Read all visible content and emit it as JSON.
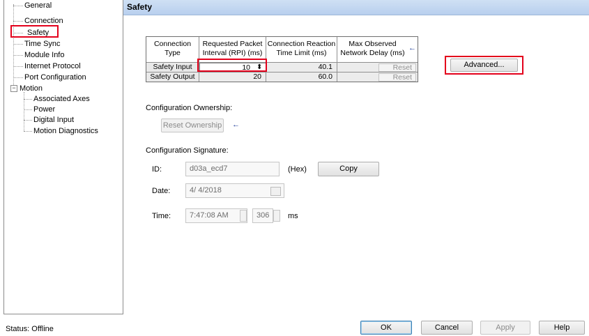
{
  "tree": {
    "items": [
      {
        "label": "General"
      },
      {
        "label": "Connection"
      },
      {
        "label": "Safety"
      },
      {
        "label": "Time Sync"
      },
      {
        "label": "Module Info"
      },
      {
        "label": "Internet Protocol"
      },
      {
        "label": "Port Configuration"
      },
      {
        "label": "Motion"
      },
      {
        "label": "Associated Axes"
      },
      {
        "label": "Power"
      },
      {
        "label": "Digital Input"
      },
      {
        "label": "Motion Diagnostics"
      }
    ],
    "expander_symbol": "−"
  },
  "page": {
    "title": "Safety"
  },
  "table": {
    "headers": [
      [
        "Connection",
        "Type"
      ],
      [
        "Requested Packet",
        "Interval (RPI) (ms)"
      ],
      [
        "Connection Reaction",
        "Time Limit (ms)"
      ],
      [
        "Max Observed",
        "Network Delay (ms)"
      ]
    ],
    "rows": [
      {
        "type": "Safety Input",
        "rpi": "10",
        "reaction": "40.1",
        "delay": "",
        "reset": "Reset"
      },
      {
        "type": "Safety Output",
        "rpi": "20",
        "reaction": "60.0",
        "delay": "",
        "reset": "Reset"
      }
    ],
    "spinner_glyph": "⬍"
  },
  "advanced_button": "Advanced...",
  "ownership": {
    "label": "Configuration Ownership:",
    "reset_button": "Reset Ownership",
    "arrow": "←"
  },
  "signature": {
    "label": "Configuration Signature:",
    "id_label": "ID:",
    "id_value": "d03a_ecd7",
    "hex_label": "(Hex)",
    "copy_button": "Copy",
    "date_label": "Date:",
    "date_value": "4/ 4/2018",
    "time_label": "Time:",
    "time_value": "7:47:08 AM",
    "ms_value": "306",
    "ms_label": "ms"
  },
  "header_arrow": "←",
  "status": "Status: Offline",
  "buttons": {
    "ok": "OK",
    "cancel": "Cancel",
    "apply": "Apply",
    "help": "Help"
  }
}
